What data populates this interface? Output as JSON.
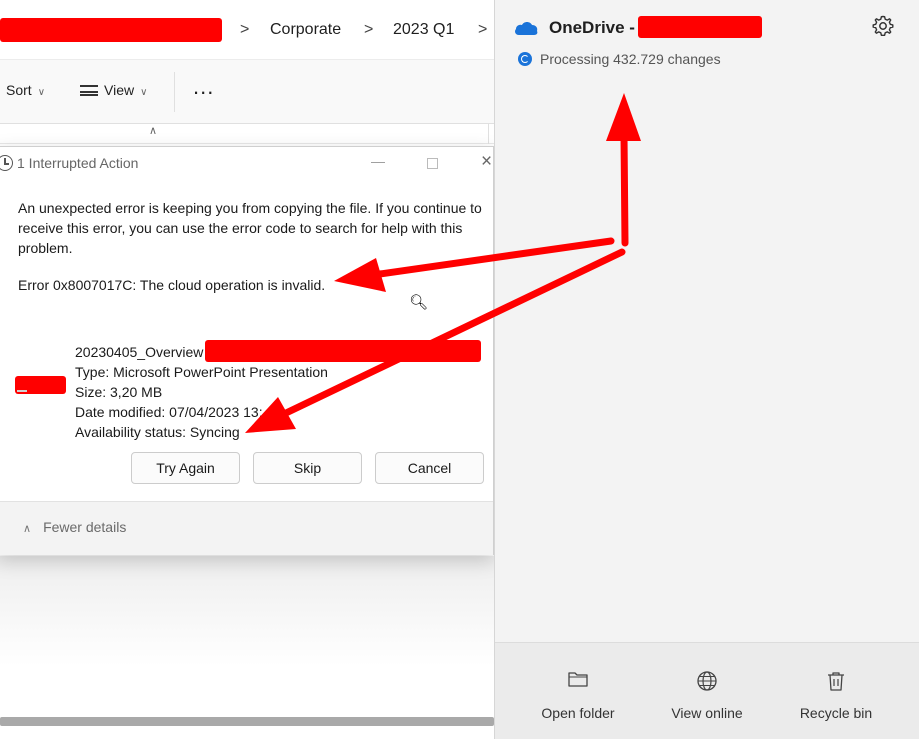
{
  "explorer": {
    "breadcrumb": {
      "items": [
        "Corporate",
        "2023 Q1"
      ],
      "separator": ">"
    },
    "toolbar": {
      "sort_label": "Sort",
      "view_label": "View",
      "more_label": "..."
    }
  },
  "dialog": {
    "title": "1 Interrupted Action",
    "minimize_label": "—",
    "close_label": "×",
    "message": "An unexpected error is keeping you from copying the file. If you continue to receive this error, you can use the error code to search for help with this problem.",
    "error_text": "Error 0x8007017C: The cloud operation is invalid.",
    "file": {
      "name": "20230405_Overview",
      "type": "Type: Microsoft PowerPoint Presentation",
      "size": "Size: 3,20 MB",
      "date_modified": "Date modified: 07/04/2023 13:",
      "availability": "Availability status: Syncing"
    },
    "buttons": {
      "try_again": "Try Again",
      "skip": "Skip",
      "cancel": "Cancel"
    },
    "fewer_details": "Fewer details"
  },
  "onedrive": {
    "title": "OneDrive - ",
    "status": "Processing 432.729 changes",
    "footer": {
      "open_folder": "Open folder",
      "view_online": "View online",
      "recycle_bin": "Recycle bin"
    }
  },
  "colors": {
    "annotation_red": "#ff0000",
    "onedrive_blue": "#1a73d9"
  },
  "icons": {
    "settings": "gear-icon",
    "sync": "sync-icon",
    "zoom": "zoom-in-icon"
  }
}
